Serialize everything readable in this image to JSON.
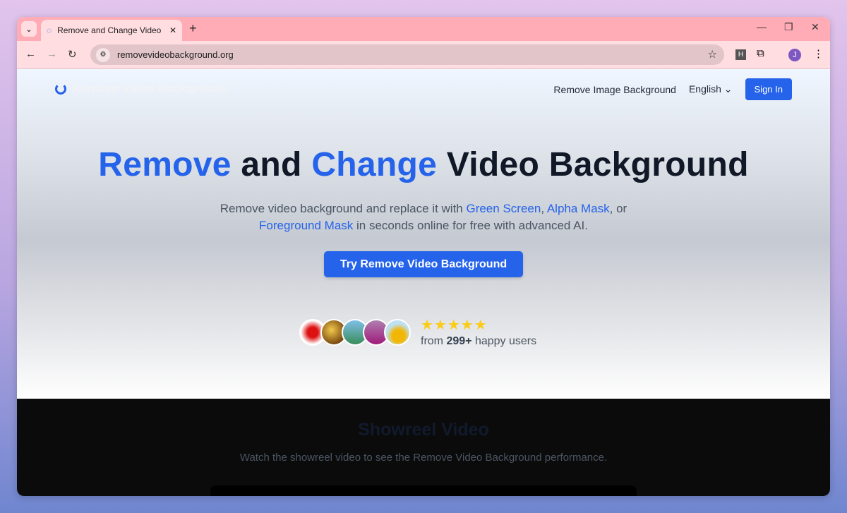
{
  "browser": {
    "tab_title": "Remove and Change Video Background",
    "url": "removevideobackground.org",
    "profile_initial": "J",
    "extension_label": "H"
  },
  "header": {
    "logo": "Remove Video Background",
    "nav_link": "Remove Image Background",
    "language": "English",
    "signin": "Sign In"
  },
  "hero": {
    "title_1": "Remove",
    "title_2": " and ",
    "title_3": "Change",
    "title_4": " Video Background",
    "sub_1": "Remove video background and replace it with ",
    "link_green": "Green Screen",
    "sub_2": ", ",
    "link_alpha": "Alpha Mask",
    "sub_3": ", or ",
    "link_fg": "Foreground Mask",
    "sub_4": " in seconds online for free with advanced AI.",
    "cta": "Try Remove Video Background",
    "stars": "★★★★★",
    "rating": 5,
    "users_pre": "from ",
    "users_count": "299+",
    "users_post": " happy users"
  },
  "showreel": {
    "title": "Showreel Video",
    "desc": "Watch the showreel video to see the Remove Video Background performance."
  },
  "colors": {
    "accent": "#2563eb",
    "star": "#facc15"
  }
}
